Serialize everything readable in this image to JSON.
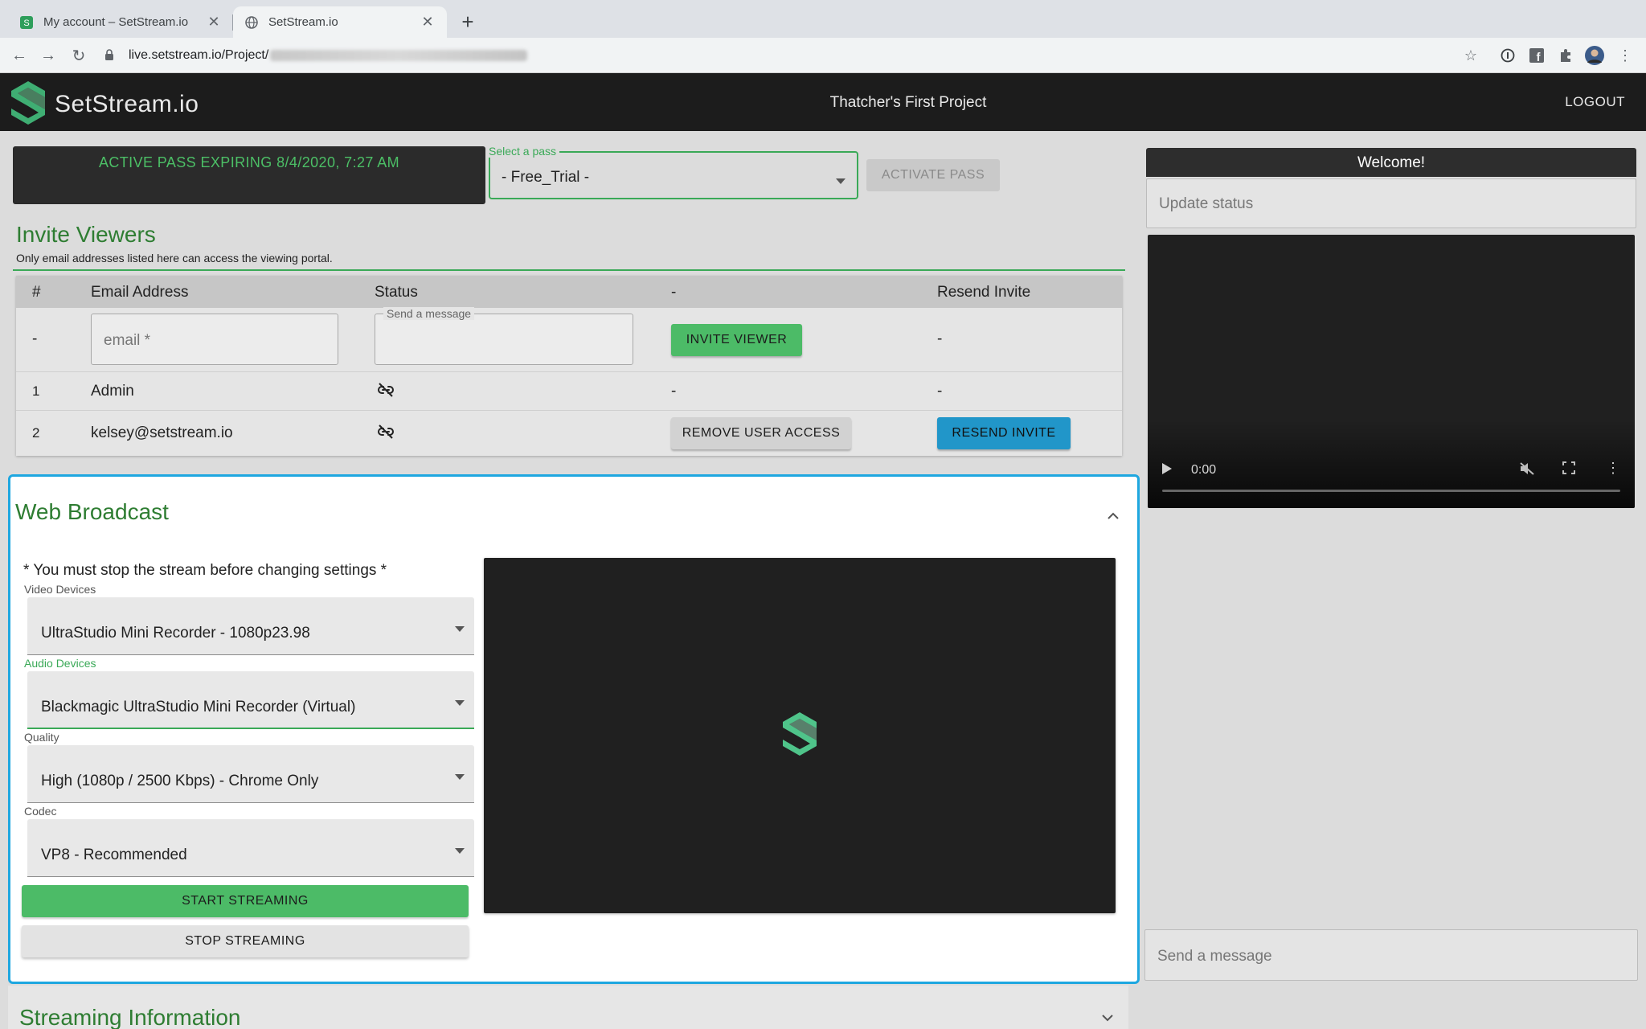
{
  "browser": {
    "tabs": [
      {
        "title": "My account – SetStream.io",
        "active": false
      },
      {
        "title": "SetStream.io",
        "active": true
      }
    ],
    "url": "live.setstream.io/Project/"
  },
  "header": {
    "brand": "SetStream.io",
    "project_title": "Thatcher's First Project",
    "logout_label": "LOGOUT"
  },
  "pass": {
    "status_text": "ACTIVE PASS EXPIRING 8/4/2020, 7:27 AM",
    "select_label": "Select a pass",
    "select_value": "- Free_Trial -",
    "activate_label": "ACTIVATE PASS"
  },
  "invite": {
    "title": "Invite Viewers",
    "description": "Only email addresses listed here can access the viewing portal.",
    "columns": [
      "#",
      "Email Address",
      "Status",
      "-",
      "Resend Invite"
    ],
    "new_row": {
      "index": "-",
      "email_placeholder": "email *",
      "message_label": "Send a message",
      "invite_button": "INVITE VIEWER",
      "resend": "-"
    },
    "rows": [
      {
        "index": "1",
        "email": "Admin",
        "action": "-",
        "resend": "-"
      },
      {
        "index": "2",
        "email": "kelsey@setstream.io",
        "action": "REMOVE USER ACCESS",
        "resend": "RESEND INVITE"
      }
    ]
  },
  "broadcast": {
    "title": "Web Broadcast",
    "notice": "* You must stop the stream before changing settings *",
    "fields": [
      {
        "label": "Video Devices",
        "value": "UltraStudio Mini Recorder - 1080p23.98"
      },
      {
        "label": "Audio Devices",
        "value": "Blackmagic UltraStudio Mini Recorder (Virtual)"
      },
      {
        "label": "Quality",
        "value": "High (1080p / 2500 Kbps) - Chrome Only"
      },
      {
        "label": "Codec",
        "value": "VP8 - Recommended"
      }
    ],
    "start_label": "START STREAMING",
    "stop_label": "STOP STREAMING"
  },
  "streaming_info": {
    "title": "Streaming Information"
  },
  "sidebar": {
    "welcome": "Welcome!",
    "status_placeholder": "Update status",
    "video_time": "0:00",
    "chat_placeholder": "Send a message"
  },
  "colors": {
    "accent_green": "#4cbb67",
    "title_green": "#2e7d32",
    "focus_blue": "#1ea7e0",
    "resend_blue": "#2196c9",
    "header_bg": "#1c1c1c"
  },
  "icons": {
    "status_icon": "link-off-icon",
    "caret": "caret-down-icon"
  }
}
